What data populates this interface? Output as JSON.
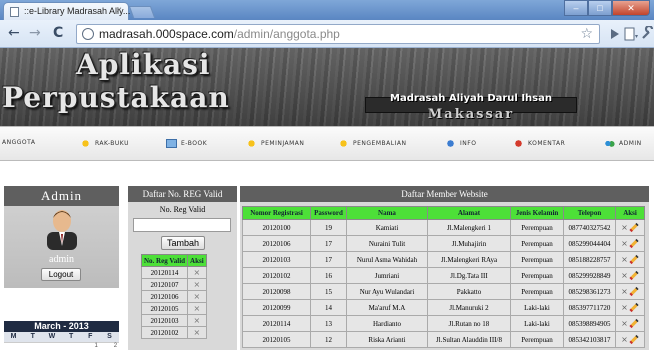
{
  "browser": {
    "tab_title": "::e-Library Madrasah Aliy...",
    "tab_close": "×",
    "url_domain": "madrasah.000space.com",
    "url_path": "/admin/anggota.php",
    "nav_back": "←",
    "nav_forward": "→",
    "nav_reload": "C",
    "bookmark_star": "☆"
  },
  "banner": {
    "logo_line1": "Aplikasi",
    "logo_line2": "Perpustakaan",
    "plaque_line1": "Madrasah Aliyah Darul Ihsan",
    "plaque_line2": "Makassar"
  },
  "menu": [
    {
      "label": "ANGGOTA",
      "icon": "none"
    },
    {
      "label": "RAK-BUKU",
      "icon": "star-icon"
    },
    {
      "label": "E-BOOK",
      "icon": "ebook-icon"
    },
    {
      "label": "PEMINJAMAN",
      "icon": "star-icon"
    },
    {
      "label": "PENGEMBALIAN",
      "icon": "star-icon"
    },
    {
      "label": "INFO",
      "icon": "info-icon"
    },
    {
      "label": "KOMENTAR",
      "icon": "comment-icon"
    },
    {
      "label": "ADMIN",
      "icon": "admin-icon"
    }
  ],
  "sidebar": {
    "heading": "Admin",
    "username": "admin",
    "logout_label": "Logout",
    "calendar_title": "March - 2013",
    "calendar_days": [
      "M",
      "T",
      "W",
      "T",
      "F",
      "S"
    ],
    "calendar_first_row": [
      "",
      "",
      "",
      "",
      "1",
      "2"
    ]
  },
  "reg_panel": {
    "heading": "Daftar No. REG Valid",
    "field_label": "No. Reg Valid",
    "input_value": "",
    "button_label": "Tambah",
    "columns": [
      "No. Reg Valid",
      "Aksi"
    ],
    "rows": [
      "20120114",
      "20120107",
      "20120106",
      "20120105",
      "20120103",
      "20120102"
    ],
    "delete_glyph": "×"
  },
  "members": {
    "heading": "Daftar Member Website",
    "columns": [
      "Nomor Registrasi",
      "Password",
      "Nama",
      "Alamat",
      "Jenis Kelamin",
      "Telepon",
      "Aksi"
    ],
    "rows": [
      [
        "20120100",
        "19",
        "Kamiati",
        "Jl.Malengkeri 1",
        "Perempuan",
        "087740327542"
      ],
      [
        "20120106",
        "17",
        "Nuraini Tulit",
        "Jl.Muhajirin",
        "Perempuan",
        "085299044404"
      ],
      [
        "20120103",
        "17",
        "Nurul Asma Wahidah",
        "Jl.Malengkeri RAya",
        "Perempuan",
        "085188228757"
      ],
      [
        "20120102",
        "16",
        "Jumriani",
        "Jl.Dg.Tata III",
        "Perempuan",
        "085299928849"
      ],
      [
        "20120098",
        "15",
        "Nur Ayu Wulandari",
        "Pakkatto",
        "Perempuan",
        "085298361273"
      ],
      [
        "20120099",
        "14",
        "Ma'aruf M.A",
        "Jl.Manuruki 2",
        "Laki-laki",
        "085397711720"
      ],
      [
        "20120114",
        "13",
        "Hardianto",
        "Jl.Rutan no 18",
        "Laki-laki",
        "085398894905"
      ],
      [
        "20120105",
        "12",
        "Riska Arianti",
        "Jl.Sultan Alauddin III/8",
        "Perempuan",
        "085342103817"
      ]
    ],
    "delete_glyph": "×"
  },
  "colors": {
    "header_green": "#4de038",
    "panel_heading": "#5f5f5f",
    "panel_body": "#d9d9d9",
    "calendar_head": "#1f2b42"
  }
}
